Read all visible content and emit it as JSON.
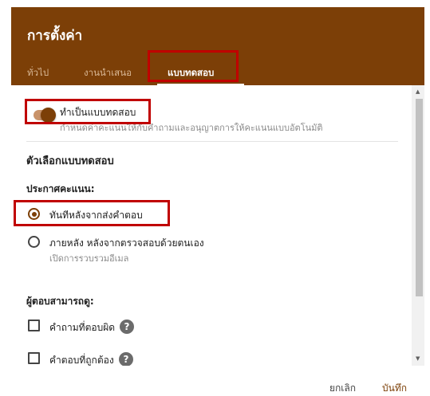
{
  "dialog": {
    "title": "การตั้งค่า"
  },
  "tabs": [
    {
      "label": "ทั่วไป"
    },
    {
      "label": "งานนำเสนอ"
    },
    {
      "label": "แบบทดสอบ"
    }
  ],
  "quiz_toggle": {
    "label": "ทำเป็นแบบทดสอบ",
    "description": "กำหนดค่าคะแนนให้กับคำถามและอนุญาตการให้คะแนนแบบอัตโนมัติ",
    "enabled": true
  },
  "section": {
    "title": "ตัวเลือกแบบทดสอบ"
  },
  "release": {
    "label": "ประกาศคะแนน:",
    "options": [
      {
        "label": "ทันทีหลังจากส่งคำตอบ",
        "sublabel": "",
        "checked": true
      },
      {
        "label": "ภายหลัง หลังจากตรวจสอบด้วยตนเอง",
        "sublabel": "เปิดการรวบรวมอีเมล",
        "checked": false
      }
    ]
  },
  "respondents": {
    "label": "ผู้ตอบสามารถดู:",
    "options": [
      {
        "label": "คำถามที่ตอบผิด",
        "checked": false
      },
      {
        "label": "คำตอบที่ถูกต้อง",
        "checked": false
      }
    ]
  },
  "footer": {
    "cancel": "ยกเลิก",
    "save": "บันทึก"
  },
  "colors": {
    "header": "#7c3f07",
    "highlight": "#c00000",
    "accent": "#7c3f07"
  },
  "icons": {
    "help": "help-icon",
    "scroll_up": "scroll-up-icon",
    "scroll_down": "scroll-down-icon"
  }
}
